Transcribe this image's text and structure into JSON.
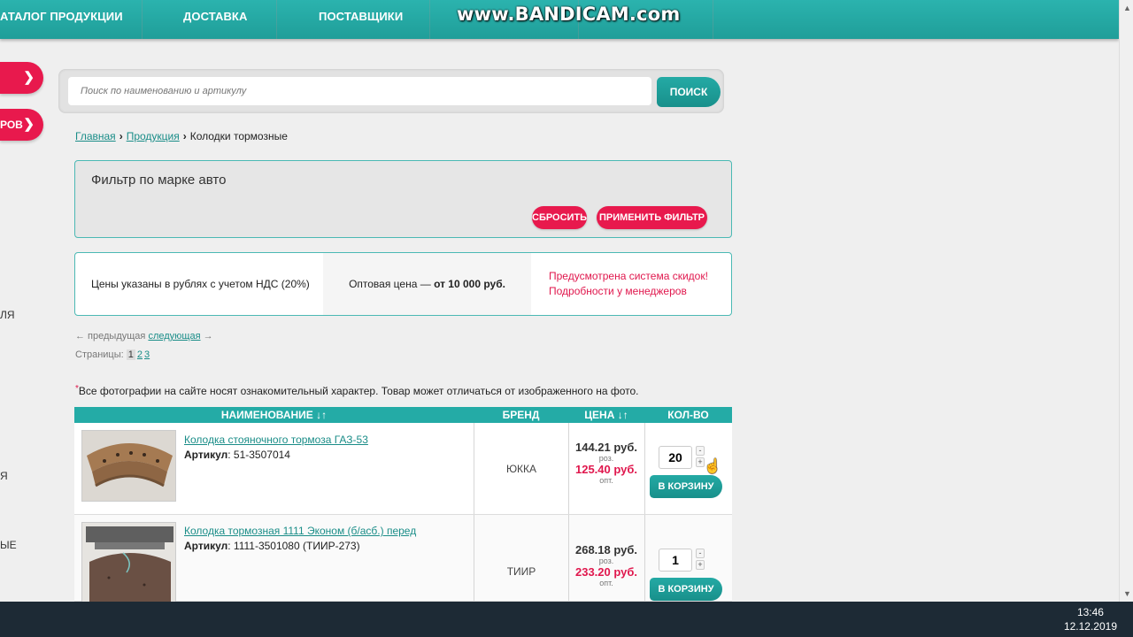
{
  "nav": {
    "items": [
      "АТАЛОГ ПРОДУКЦИИ",
      "ДОСТАВКА",
      "ПОСТАВЩИКИ"
    ],
    "watermark": "www.BANDICAM.com"
  },
  "sidebar": {
    "tab2_label": "РОВ",
    "fragments": [
      "ЛЯ",
      "Я",
      "ЫЕ"
    ]
  },
  "search": {
    "placeholder": "Поиск по наименованию и артикулу",
    "button_label": "ПОИСК"
  },
  "breadcrumb": {
    "home": "Главная",
    "products": "Продукция",
    "current": "Колодки тормозные",
    "separator": "›"
  },
  "filter": {
    "title": "Фильтр по марке авто",
    "reset_label": "СБРОСИТЬ",
    "apply_label": "ПРИМЕНИТЬ ФИЛЬТР"
  },
  "info": {
    "vat_note": "Цены указаны в рублях с учетом НДС (20%)",
    "wholesale_prefix": "Оптовая цена — ",
    "wholesale_value": "от 10 000 руб.",
    "discount_line1": "Предусмотрена система скидок!",
    "discount_line2": "Подробности у менеджеров"
  },
  "pagination": {
    "prev": "← предыдущая",
    "next": "следующая",
    "next_arrow": "→",
    "pages_label": "Страницы:",
    "pages": [
      "1",
      "2",
      "3"
    ]
  },
  "photo_note": "Все фотографии на сайте носят ознакомительный характер. Товар может отличаться от изображенного на фото.",
  "table": {
    "headers": {
      "name": "НАИМЕНОВАНИЕ",
      "brand": "БРЕНД",
      "price": "ЦЕНА",
      "qty": "КОЛ-ВО"
    },
    "sort_icon": "↓↑",
    "article_label": "Артикул",
    "retail_label": "роз.",
    "wholesale_label": "опт.",
    "cart_label": "В КОРЗИНУ",
    "rows": [
      {
        "name": "Колодка стояночного тормоза ГАЗ-53",
        "article": ": 51-3507014",
        "brand": "ЮККА",
        "retail_price": "144.21 руб.",
        "wholesale_price": "125.40 руб.",
        "qty": "20"
      },
      {
        "name": "Колодка тормозная 1111 Эконом (б/асб.) перед",
        "article": ": 1111-3501080 (ТИИР-273)",
        "brand": "ТИИР",
        "retail_price": "268.18 руб.",
        "wholesale_price": "233.20 руб.",
        "qty": "1"
      }
    ]
  },
  "taskbar": {
    "time": "13:46",
    "date": "12.12.2019"
  }
}
